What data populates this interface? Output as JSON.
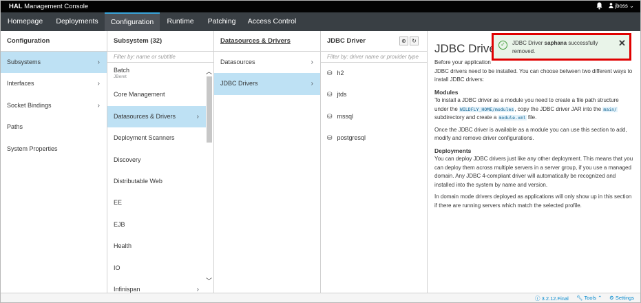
{
  "header": {
    "brand_bold": "HAL",
    "brand_rest": " Management Console",
    "bell_icon": "bell-icon",
    "user_label": "jboss ⌄"
  },
  "nav": {
    "tabs": [
      {
        "label": "Homepage"
      },
      {
        "label": "Deployments"
      },
      {
        "label": "Configuration",
        "active": true
      },
      {
        "label": "Runtime"
      },
      {
        "label": "Patching"
      },
      {
        "label": "Access Control"
      }
    ]
  },
  "columns": {
    "configuration": {
      "title": "Configuration",
      "items": [
        {
          "label": "Subsystems"
        },
        {
          "label": "Interfaces"
        },
        {
          "label": "Socket Bindings"
        },
        {
          "label": "Paths"
        },
        {
          "label": "System Properties"
        }
      ]
    },
    "subsystem": {
      "title": "Subsystem (32)",
      "filter_placeholder": "Filter by: name or subtitle",
      "items": [
        {
          "label": "Batch",
          "sub": "JBeret"
        },
        {
          "label": "Core Management"
        },
        {
          "label": "Datasources & Drivers"
        },
        {
          "label": "Deployment Scanners"
        },
        {
          "label": "Discovery"
        },
        {
          "label": "Distributable Web"
        },
        {
          "label": "EE"
        },
        {
          "label": "EJB"
        },
        {
          "label": "Health"
        },
        {
          "label": "IO"
        },
        {
          "label": "Infinispan"
        }
      ]
    },
    "datasources": {
      "title": "Datasources & Drivers",
      "items": [
        {
          "label": "Datasources"
        },
        {
          "label": "JDBC Drivers"
        }
      ]
    },
    "jdbc": {
      "title": "JDBC Driver",
      "filter_placeholder": "Filter by: driver name or provider type",
      "items": [
        {
          "label": "h2"
        },
        {
          "label": "jtds"
        },
        {
          "label": "mssql"
        },
        {
          "label": "postgresql"
        }
      ]
    }
  },
  "description": {
    "title": "JDBC Drivers",
    "intro_1": "Before your application",
    "intro_2": "JDBC drivers need to be installed. You can choose between two different ways to install JDBC drivers:",
    "modules_heading": "Modules",
    "modules_p1_a": "To install a JDBC driver as a module you need to create a file path structure under the",
    "modules_code1": "WILDFLY_HOME/modules",
    "modules_p1_b": ", copy the JDBC driver JAR into the",
    "modules_code2": "main/",
    "modules_p1_c": "subdirectory and create a",
    "modules_code3": "module.xml",
    "modules_p1_d": "file.",
    "modules_p2": "Once the JDBC driver is available as a module you can use this section to add, modify and remove driver configurations.",
    "deployments_heading": "Deployments",
    "deployments_p1": "You can deploy JDBC drivers just like any other deployment. This means that you can deploy them across multiple servers in a server group, if you use a managed domain. Any JDBC 4-compliant driver will automatically be recognized and installed into the system by name and version.",
    "deployments_p2": "In domain mode drivers deployed as applications will only show up in this section if there are running servers which match the selected profile."
  },
  "notification": {
    "prefix": "JDBC Driver ",
    "name": "saphana",
    "suffix": " successfully removed.",
    "close": "✕"
  },
  "footer": {
    "version": "3.2.12.Final",
    "tools": "Tools ⌃",
    "settings": "Settings"
  },
  "colors": {
    "accent": "#39a5dc",
    "selected_bg": "#bee1f4",
    "success": "#3f9c35",
    "highlight_border": "#e00000"
  }
}
